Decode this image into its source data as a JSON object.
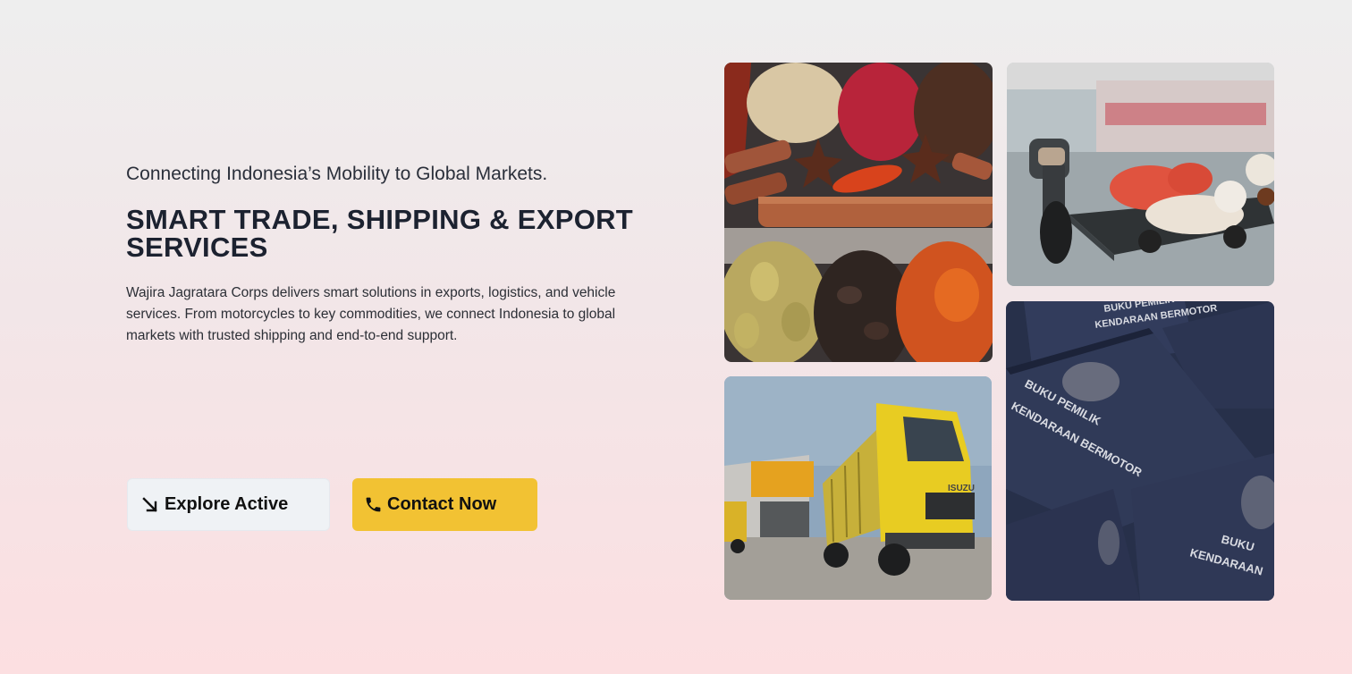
{
  "hero": {
    "tagline": "Connecting Indonesia’s Mobility to Global Markets.",
    "headline": "SMART TRADE, SHIPPING & EXPORT SERVICES",
    "description": "Wajira Jagratara Corps delivers smart solutions in exports, logistics, and vehicle services. From motorcycles to key commodities, we connect Indonesia to global markets with trusted shipping and end-to-end support."
  },
  "buttons": {
    "explore": {
      "label": "Explore Active",
      "icon": "arrow-down-right-icon"
    },
    "contact": {
      "label": "Contact Now",
      "icon": "phone-icon",
      "color": "#f2c233"
    }
  },
  "photos": {
    "books_text_1": "BUKU PEMILIK",
    "books_text_2": "KENDARAAN BERMOTOR",
    "books_text_3": "BUKU PEMILIK",
    "books_text_4": "KENDARAAN BERMOTOR",
    "books_text_5": "BUKU",
    "books_text_6": "KENDARAAN",
    "truck_text": "ISUZU"
  },
  "colors": {
    "accent": "#f2c233",
    "heading": "#1c2230",
    "secondary_button": "#eff2f5"
  }
}
